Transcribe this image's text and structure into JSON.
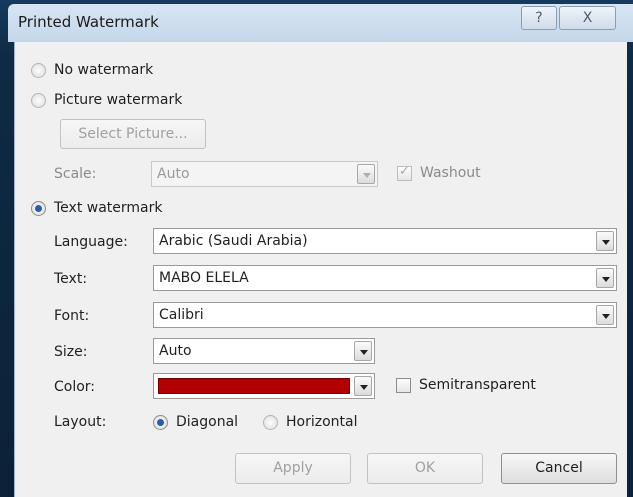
{
  "dialog": {
    "title": "Printed Watermark",
    "help_glyph": "?",
    "close_glyph": "X"
  },
  "options": {
    "no_watermark": "No watermark",
    "picture_watermark": "Picture watermark",
    "text_watermark": "Text watermark",
    "selected": "text_watermark"
  },
  "picture": {
    "select_button": "Select Picture...",
    "scale_label": "Scale:",
    "scale_value": "Auto",
    "washout_label": "Washout",
    "washout_checked": true
  },
  "text": {
    "language_label": "Language:",
    "language_value": "Arabic (Saudi Arabia)",
    "text_label": "Text:",
    "text_value": "MABO ELELA",
    "font_label": "Font:",
    "font_value": "Calibri",
    "size_label": "Size:",
    "size_value": "Auto",
    "color_label": "Color:",
    "color_value": "#b00000",
    "semitransparent_label": "Semitransparent",
    "semitransparent_checked": false,
    "layout_label": "Layout:",
    "layout_diagonal": "Diagonal",
    "layout_horizontal": "Horizontal",
    "layout_selected": "diagonal"
  },
  "buttons": {
    "apply": "Apply",
    "ok": "OK",
    "cancel": "Cancel"
  }
}
